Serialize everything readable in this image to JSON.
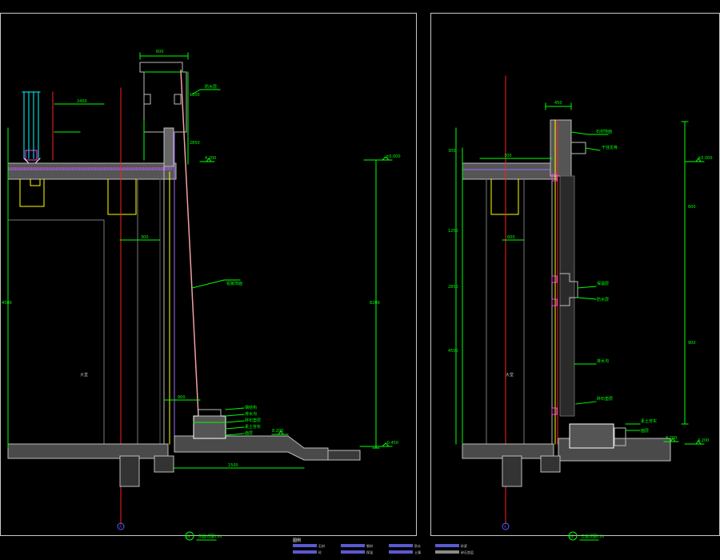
{
  "drawing": {
    "background": "#000000",
    "colors": {
      "frame": "#c8c8c8",
      "green": "#00ff00",
      "yellow": "#ffff00",
      "red": "#ff2020",
      "magenta": "#ff40ff",
      "cyan": "#00ffff",
      "white": "#ffffff",
      "grey": "#8c8c8c",
      "purple": "#9a6bff",
      "legend_blue": "#5a5ad0"
    }
  },
  "sheets": [
    {
      "id": "left",
      "label_text": "剖面详图",
      "label_scale": "1:20",
      "marker": "01",
      "room_label": "大堂",
      "axis_marker": "A",
      "dims_vertical": [
        "1200",
        "2850",
        "4500",
        "8200"
      ],
      "dims_horizontal": [
        "600",
        "300",
        "1500",
        "2400",
        "900"
      ],
      "levels": [
        "±0.000",
        "-0.450",
        "4.200",
        "8.200"
      ],
      "callouts": [
        "防水层",
        "铝板饰面",
        "钢结构",
        "排水沟",
        "碎石垫层",
        "素土夯实",
        "面层"
      ]
    },
    {
      "id": "right",
      "label_text": "立面详图",
      "label_scale": "1:20",
      "marker": "02",
      "room_label": "大堂",
      "axis_marker": "A",
      "dims_vertical": [
        "300",
        "1200",
        "2850",
        "4500",
        "600",
        "900"
      ],
      "dims_horizontal": [
        "450",
        "300",
        "600"
      ],
      "levels": [
        "±0.000",
        "4.200",
        "8.200"
      ],
      "callouts": [
        "石材饰面",
        "干挂龙骨",
        "保温层",
        "防水层",
        "排水沟",
        "碎石垫层",
        "素土夯实",
        "面层"
      ]
    }
  ],
  "legend": {
    "title": "图例",
    "items": [
      {
        "swatch": "hatch",
        "label": "石材"
      },
      {
        "swatch": "solid",
        "label": "砼"
      },
      {
        "swatch": "hatch",
        "label": "钢材"
      },
      {
        "swatch": "solid",
        "label": "保温"
      },
      {
        "swatch": "solid",
        "label": "防水"
      },
      {
        "swatch": "solid",
        "label": "土壤"
      },
      {
        "swatch": "solid",
        "label": "砂浆"
      },
      {
        "swatch": "hatch",
        "label": "碎石垫层"
      }
    ]
  }
}
